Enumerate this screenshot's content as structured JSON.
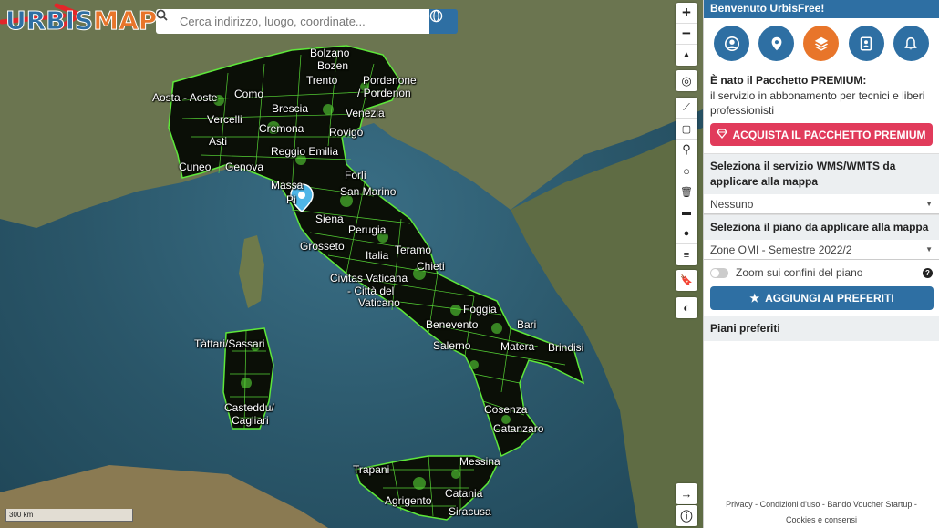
{
  "logo": {
    "part1": "URBIS",
    "part2": "MAP"
  },
  "search": {
    "placeholder": "Cerca indirizzo, luogo, coordinate..."
  },
  "scale": {
    "label": "300 km"
  },
  "map_labels": [
    "Bolzano",
    "Bozen",
    "Trento",
    "Pordenone",
    "/ Pordenon",
    "Aosta - Aoste",
    "Como",
    "Vercelli",
    "Brescia",
    "Venezia",
    "Cremona",
    "Rovigo",
    "Asti",
    "Reggio Emilia",
    "Cuneo",
    "Genova",
    "Forlì",
    "Massa",
    "Pi",
    "San Marino",
    "Siena",
    "Perugia",
    "Grosseto",
    "Italia",
    "Teramo",
    "Chieti",
    "Civitas Vaticana",
    "- Città del",
    "Vaticano",
    "Foggia",
    "Benevento",
    "Bari",
    "Salerno",
    "Matera",
    "Brindisi",
    "Tàttari/Sassari",
    "Casteddu/",
    "Cagliari",
    "Cosenza",
    "Catanzaro",
    "Messina",
    "Trapani",
    "Catania",
    "Agrigento",
    "Siracusa"
  ],
  "panel": {
    "header": "Benvenuto UrbisFree!",
    "promo_title": "È nato il Pacchetto PREMIUM:",
    "promo_text": "il servizio in abbonamento per tecnici e liberi professionisti",
    "premium_button": "ACQUISTA IL PACCHETTO PREMIUM",
    "wms_title": "Seleziona il servizio WMS/WMTS da applicare alla mappa",
    "wms_value": "Nessuno",
    "plan_title": "Seleziona il piano da applicare alla mappa",
    "plan_value": "Zone OMI - Semestre 2022/2",
    "zoom_label": "Zoom sui confini del piano",
    "fav_button": "AGGIUNGI AI PREFERITI",
    "favorites_title": "Piani preferiti",
    "footer": {
      "privacy": "Privacy",
      "terms": "Condizioni d'uso",
      "voucher": "Bando Voucher Startup",
      "cookies": "Cookies e consensi"
    }
  },
  "colors": {
    "brand_blue": "#2e6fa3",
    "brand_orange": "#e8752a",
    "premium_pink": "#e13b5b",
    "zone_green": "#5ee83a"
  }
}
